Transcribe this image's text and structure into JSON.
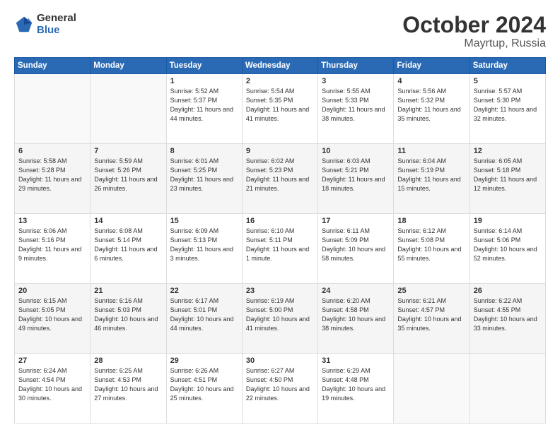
{
  "header": {
    "logo_general": "General",
    "logo_blue": "Blue",
    "month": "October 2024",
    "location": "Mayrtup, Russia"
  },
  "weekdays": [
    "Sunday",
    "Monday",
    "Tuesday",
    "Wednesday",
    "Thursday",
    "Friday",
    "Saturday"
  ],
  "weeks": [
    [
      {
        "day": "",
        "info": ""
      },
      {
        "day": "",
        "info": ""
      },
      {
        "day": "1",
        "info": "Sunrise: 5:52 AM\nSunset: 5:37 PM\nDaylight: 11 hours and 44 minutes."
      },
      {
        "day": "2",
        "info": "Sunrise: 5:54 AM\nSunset: 5:35 PM\nDaylight: 11 hours and 41 minutes."
      },
      {
        "day": "3",
        "info": "Sunrise: 5:55 AM\nSunset: 5:33 PM\nDaylight: 11 hours and 38 minutes."
      },
      {
        "day": "4",
        "info": "Sunrise: 5:56 AM\nSunset: 5:32 PM\nDaylight: 11 hours and 35 minutes."
      },
      {
        "day": "5",
        "info": "Sunrise: 5:57 AM\nSunset: 5:30 PM\nDaylight: 11 hours and 32 minutes."
      }
    ],
    [
      {
        "day": "6",
        "info": "Sunrise: 5:58 AM\nSunset: 5:28 PM\nDaylight: 11 hours and 29 minutes."
      },
      {
        "day": "7",
        "info": "Sunrise: 5:59 AM\nSunset: 5:26 PM\nDaylight: 11 hours and 26 minutes."
      },
      {
        "day": "8",
        "info": "Sunrise: 6:01 AM\nSunset: 5:25 PM\nDaylight: 11 hours and 23 minutes."
      },
      {
        "day": "9",
        "info": "Sunrise: 6:02 AM\nSunset: 5:23 PM\nDaylight: 11 hours and 21 minutes."
      },
      {
        "day": "10",
        "info": "Sunrise: 6:03 AM\nSunset: 5:21 PM\nDaylight: 11 hours and 18 minutes."
      },
      {
        "day": "11",
        "info": "Sunrise: 6:04 AM\nSunset: 5:19 PM\nDaylight: 11 hours and 15 minutes."
      },
      {
        "day": "12",
        "info": "Sunrise: 6:05 AM\nSunset: 5:18 PM\nDaylight: 11 hours and 12 minutes."
      }
    ],
    [
      {
        "day": "13",
        "info": "Sunrise: 6:06 AM\nSunset: 5:16 PM\nDaylight: 11 hours and 9 minutes."
      },
      {
        "day": "14",
        "info": "Sunrise: 6:08 AM\nSunset: 5:14 PM\nDaylight: 11 hours and 6 minutes."
      },
      {
        "day": "15",
        "info": "Sunrise: 6:09 AM\nSunset: 5:13 PM\nDaylight: 11 hours and 3 minutes."
      },
      {
        "day": "16",
        "info": "Sunrise: 6:10 AM\nSunset: 5:11 PM\nDaylight: 11 hours and 1 minute."
      },
      {
        "day": "17",
        "info": "Sunrise: 6:11 AM\nSunset: 5:09 PM\nDaylight: 10 hours and 58 minutes."
      },
      {
        "day": "18",
        "info": "Sunrise: 6:12 AM\nSunset: 5:08 PM\nDaylight: 10 hours and 55 minutes."
      },
      {
        "day": "19",
        "info": "Sunrise: 6:14 AM\nSunset: 5:06 PM\nDaylight: 10 hours and 52 minutes."
      }
    ],
    [
      {
        "day": "20",
        "info": "Sunrise: 6:15 AM\nSunset: 5:05 PM\nDaylight: 10 hours and 49 minutes."
      },
      {
        "day": "21",
        "info": "Sunrise: 6:16 AM\nSunset: 5:03 PM\nDaylight: 10 hours and 46 minutes."
      },
      {
        "day": "22",
        "info": "Sunrise: 6:17 AM\nSunset: 5:01 PM\nDaylight: 10 hours and 44 minutes."
      },
      {
        "day": "23",
        "info": "Sunrise: 6:19 AM\nSunset: 5:00 PM\nDaylight: 10 hours and 41 minutes."
      },
      {
        "day": "24",
        "info": "Sunrise: 6:20 AM\nSunset: 4:58 PM\nDaylight: 10 hours and 38 minutes."
      },
      {
        "day": "25",
        "info": "Sunrise: 6:21 AM\nSunset: 4:57 PM\nDaylight: 10 hours and 35 minutes."
      },
      {
        "day": "26",
        "info": "Sunrise: 6:22 AM\nSunset: 4:55 PM\nDaylight: 10 hours and 33 minutes."
      }
    ],
    [
      {
        "day": "27",
        "info": "Sunrise: 6:24 AM\nSunset: 4:54 PM\nDaylight: 10 hours and 30 minutes."
      },
      {
        "day": "28",
        "info": "Sunrise: 6:25 AM\nSunset: 4:53 PM\nDaylight: 10 hours and 27 minutes."
      },
      {
        "day": "29",
        "info": "Sunrise: 6:26 AM\nSunset: 4:51 PM\nDaylight: 10 hours and 25 minutes."
      },
      {
        "day": "30",
        "info": "Sunrise: 6:27 AM\nSunset: 4:50 PM\nDaylight: 10 hours and 22 minutes."
      },
      {
        "day": "31",
        "info": "Sunrise: 6:29 AM\nSunset: 4:48 PM\nDaylight: 10 hours and 19 minutes."
      },
      {
        "day": "",
        "info": ""
      },
      {
        "day": "",
        "info": ""
      }
    ]
  ]
}
